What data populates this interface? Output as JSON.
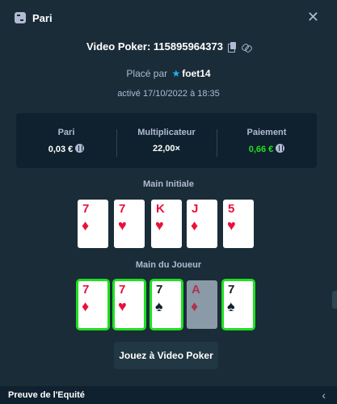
{
  "header": {
    "title": "Pari",
    "close_icon": "close-icon"
  },
  "bet": {
    "game_label": "Video Poker:",
    "bet_id": "115895964373",
    "placed_by_label": "Placé par",
    "user": "foet14",
    "date_text": "activé 17/10/2022 à 18:35"
  },
  "stats": {
    "bet_label": "Pari",
    "bet_value": "0,03 €",
    "multiplier_label": "Multiplicateur",
    "multiplier_value": "22,00×",
    "payout_label": "Paiement",
    "payout_value": "0,66 €"
  },
  "initial_hand": {
    "label": "Main Initiale",
    "cards": [
      {
        "rank": "7",
        "suit": "♦",
        "color": "red"
      },
      {
        "rank": "7",
        "suit": "♥",
        "color": "red"
      },
      {
        "rank": "K",
        "suit": "♥",
        "color": "red"
      },
      {
        "rank": "J",
        "suit": "♦",
        "color": "red"
      },
      {
        "rank": "5",
        "suit": "♥",
        "color": "red"
      }
    ]
  },
  "player_hand": {
    "label": "Main du Joueur",
    "cards": [
      {
        "rank": "7",
        "suit": "♦",
        "color": "red",
        "held": true
      },
      {
        "rank": "7",
        "suit": "♥",
        "color": "red",
        "held": true
      },
      {
        "rank": "7",
        "suit": "♠",
        "color": "black",
        "held": true
      },
      {
        "rank": "A",
        "suit": "♦",
        "color": "red",
        "held": false
      },
      {
        "rank": "7",
        "suit": "♠",
        "color": "black",
        "held": true
      }
    ]
  },
  "play_button": "Jouez à Video Poker",
  "footer": {
    "label": "Preuve de l'Equité"
  },
  "colors": {
    "background": "#1a2c38",
    "panel": "#0f212e",
    "accent_green": "#1fe020",
    "red_suit": "#e9113c"
  }
}
